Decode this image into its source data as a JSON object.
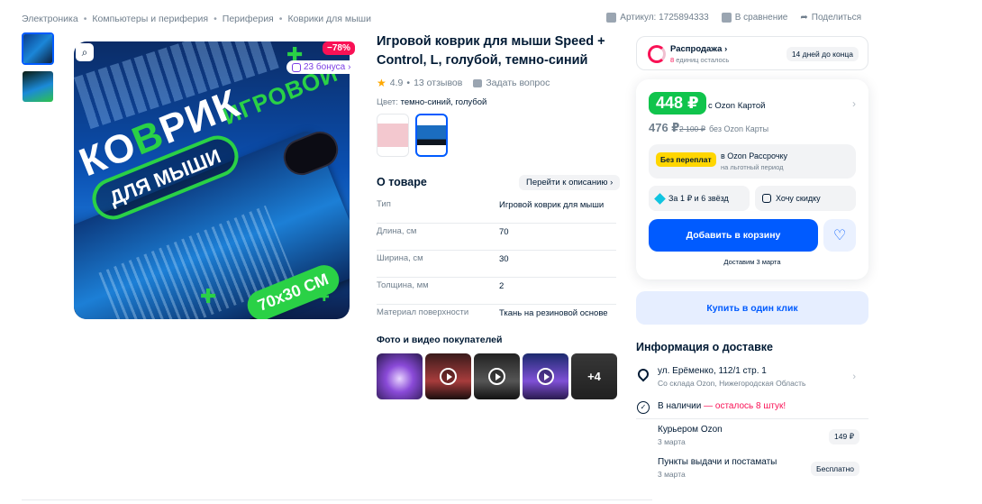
{
  "breadcrumb": [
    "Электроника",
    "Компьютеры и периферия",
    "Периферия",
    "Коврики для мыши"
  ],
  "top_actions": {
    "article": "Артикул: 1725894333",
    "compare": "В сравнение",
    "share": "Поделиться"
  },
  "gallery": {
    "discount": "−78%",
    "bonus": "23 бонуса",
    "image_text": {
      "word1_a": "КО",
      "word1_b": "В",
      "word1_c": "РИК",
      "word2": "ИГРОВОЙ",
      "pill": "ДЛЯ МЫШИ",
      "size": "70x30 СМ"
    }
  },
  "product": {
    "title": "Игровой коврик для мыши Speed + Control, L, голубой, темно-синий",
    "rating": "4.9",
    "reviews": "13 отзывов",
    "ask": "Задать вопрос",
    "color_label": "Цвет:",
    "color_value": "темно-синий, голубой"
  },
  "about": {
    "title": "О товаре",
    "desc_button": "Перейти к описанию",
    "specs": [
      {
        "k": "Тип",
        "v": "Игровой коврик для мыши"
      },
      {
        "k": "Длина, см",
        "v": "70"
      },
      {
        "k": "Ширина, см",
        "v": "30"
      },
      {
        "k": "Толщина, мм",
        "v": "2"
      },
      {
        "k": "Материал поверхности",
        "v": "Ткань на резиновой основе"
      }
    ]
  },
  "photos": {
    "title": "Фото и видео покупателей",
    "more": "+4"
  },
  "sale": {
    "title": "Распродажа",
    "left_count": "8",
    "left_text": "единиц осталось",
    "days": "14 дней до конца"
  },
  "price": {
    "main": "448 ₽",
    "main_note": "c Ozon Картой",
    "secondary": "476 ₽",
    "old": "2 100 ₽",
    "secondary_note": "без Ozon Карты",
    "install_badge": "Без переплат",
    "install_title": "в Ozon Рассрочку",
    "install_sub": "на льготный период",
    "btn_star": "За 1 ₽ и 6 звёзд",
    "btn_discount": "Хочу скидку",
    "cart": "Добавить в корзину",
    "deliver_note": "Доставим 3 марта",
    "one_click": "Купить в один клик"
  },
  "delivery": {
    "title": "Информация о доставке",
    "address": "ул. Ерёменко, 112/1 стр. 1",
    "warehouse": "Со склада Ozon, Нижегородская Область",
    "stock_a": "В наличии",
    "stock_b": " — осталось 8 штук!",
    "methods": [
      {
        "name": "Курьером Ozon",
        "date": "3 марта",
        "price": "149 ₽"
      },
      {
        "name": "Пункты выдачи и постаматы",
        "date": "3 марта",
        "price": "Бесплатно"
      }
    ]
  },
  "colors": {
    "accent": "#005bff",
    "green": "#10c44c",
    "discount": "#f91155"
  }
}
